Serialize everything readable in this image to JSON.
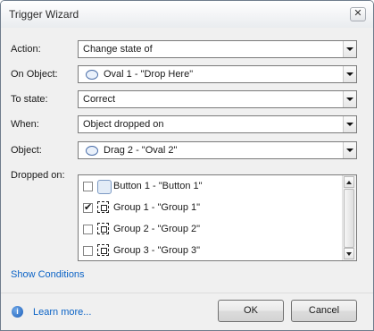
{
  "window": {
    "title": "Trigger Wizard",
    "close_glyph": "✕"
  },
  "form": {
    "action": {
      "label": "Action:",
      "value": "Change state of"
    },
    "on_object": {
      "label": "On Object:",
      "value": "Oval 1 - \"Drop Here\"",
      "icon": "oval-shape-icon"
    },
    "to_state": {
      "label": "To state:",
      "value": "Correct"
    },
    "when": {
      "label": "When:",
      "value": "Object dropped on"
    },
    "object": {
      "label": "Object:",
      "value": "Drag 2 - \"Oval 2\"",
      "icon": "oval-shape-icon"
    },
    "dropped_on": {
      "label": "Dropped on:",
      "items": [
        {
          "text": "Button 1 - \"Button 1\"",
          "checked": false,
          "check_glyph": "",
          "icon": "button-shape-icon"
        },
        {
          "text": "Group 1 - \"Group 1\"",
          "checked": true,
          "check_glyph": "✔",
          "icon": "group-icon"
        },
        {
          "text": "Group 2 - \"Group 2\"",
          "checked": false,
          "check_glyph": "",
          "icon": "group-icon"
        },
        {
          "text": "Group 3 - \"Group 3\"",
          "checked": false,
          "check_glyph": "",
          "icon": "group-icon"
        }
      ]
    }
  },
  "links": {
    "show_conditions": "Show Conditions",
    "learn_more": "Learn more..."
  },
  "buttons": {
    "ok": "OK",
    "cancel": "Cancel"
  },
  "colors": {
    "link": "#0b63c6",
    "info_icon": "#1b5fb9"
  }
}
